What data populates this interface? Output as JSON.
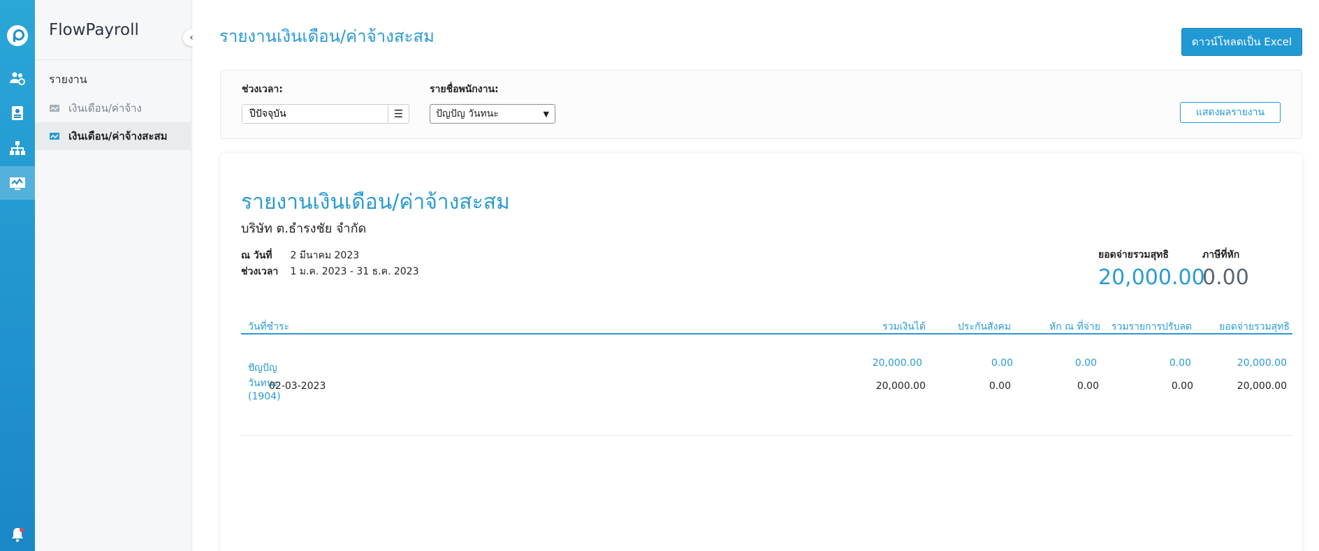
{
  "app": {
    "name": "FlowPayroll"
  },
  "sidebar": {
    "section": "รายงาน",
    "items": [
      {
        "label": "เงินเดือน/ค่าจ้าง",
        "icon": "report-icon"
      },
      {
        "label": "เงินเดือน/ค่าจ้างสะสม",
        "icon": "chart-icon",
        "active": true
      }
    ]
  },
  "header": {
    "title": "รายงานเงินเดือน/ค่าจ้างสะสม",
    "download_label": "ดาวน์โหลดเป็น Excel"
  },
  "filter": {
    "period_label": "ช่วงเวลา:",
    "period_value": "ปีปัจจุบัน",
    "employee_label": "รายชื่อพนักงาน:",
    "employee_value": "ปัญปัญ วันทนะ",
    "show_label": "แสดงผลรายงาน"
  },
  "report": {
    "title": "รายงานเงินเดือน/ค่าจ้างสะสม",
    "company": "บริษัท ต.ธำรงชัย จำกัด",
    "date_key": "ณ วันที่",
    "date_value": "2 มีนาคม 2023",
    "period_key": "ช่วงเวลา",
    "period_value": "1 ม.ค. 2023 - 31 ธ.ค. 2023",
    "net_label": "ยอดจ่ายรวมสุทธิ",
    "net_value": "20,000.00",
    "tax_label": "ภาษีที่หัก",
    "tax_value": "0.00",
    "columns": [
      "วันที่ชำระ",
      "รวมเงินได้",
      "ประกันสังคม",
      "หัก ณ ที่จ่าย",
      "รวมรายการปรับลด",
      "ยอดจ่ายรวมสุทธิ"
    ],
    "group": {
      "name": "ปัญปัญ วันทนะ (1904)",
      "values": [
        "20,000.00",
        "0.00",
        "0.00",
        "0.00",
        "20,000.00"
      ]
    },
    "rows": [
      {
        "date": "02-03-2023",
        "values": [
          "20,000.00",
          "0.00",
          "0.00",
          "0.00",
          "20,000.00"
        ]
      }
    ]
  },
  "colors": {
    "accent": "#2a9ad4",
    "rail": "#1a87c7",
    "muted": "#5b6570"
  }
}
